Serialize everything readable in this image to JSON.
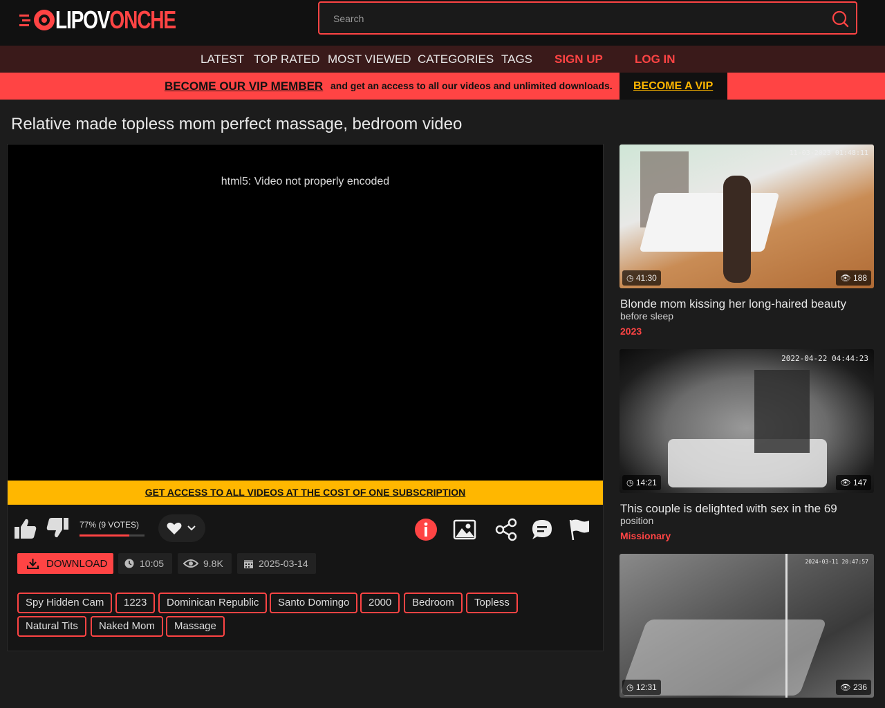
{
  "brand": {
    "name_white": "LIPOV",
    "name_red": "ONCHE",
    "prefix": "LI",
    "accent": "#ff4444"
  },
  "search": {
    "placeholder": "Search"
  },
  "nav": {
    "latest": "LATEST",
    "top_rated": "TOP RATED",
    "most_viewed": "MOST VIEWED",
    "categories": "CATEGORIES",
    "tags": "TAGS",
    "sign_up": "SIGN UP",
    "log_in": "LOG IN"
  },
  "vip": {
    "link": "BECOME OUR VIP MEMBER",
    "text": "and get an access to all our videos and unlimited downloads.",
    "button": "BECOME A VIP"
  },
  "video": {
    "title": "Relative made topless mom perfect massage, bedroom video",
    "error": "html5: Video not properly encoded",
    "promo": "GET ACCESS TO ALL VIDEOS AT THE COST OF ONE SUBSCRIPTION",
    "rating": "77% (9 VOTES)",
    "rating_fraction": 0.77,
    "download": "DOWNLOAD",
    "duration": "10:05",
    "views": "9.8K",
    "date": "2025-03-14",
    "tags": [
      "Spy Hidden Cam",
      "1223",
      "Dominican Republic",
      "Santo Domingo",
      "2000",
      "Bedroom",
      "Topless",
      "Natural Tits",
      "Naked Mom",
      "Massage"
    ]
  },
  "related": [
    {
      "duration": "41:30",
      "views": "188",
      "title": "Blonde mom kissing her long-haired beauty",
      "subtitle": "before sleep",
      "category": "2023",
      "stamp": "11-03-2023 01:48:11"
    },
    {
      "duration": "14:21",
      "views": "147",
      "title": "This couple is delighted with sex in the 69",
      "subtitle": "position",
      "category": "Missionary",
      "stamp": "2022-04-22 04:44:23"
    },
    {
      "duration": "12:31",
      "views": "236",
      "title": "",
      "subtitle": "",
      "category": "",
      "stamp": "2024-03-11 20:47:57"
    }
  ]
}
